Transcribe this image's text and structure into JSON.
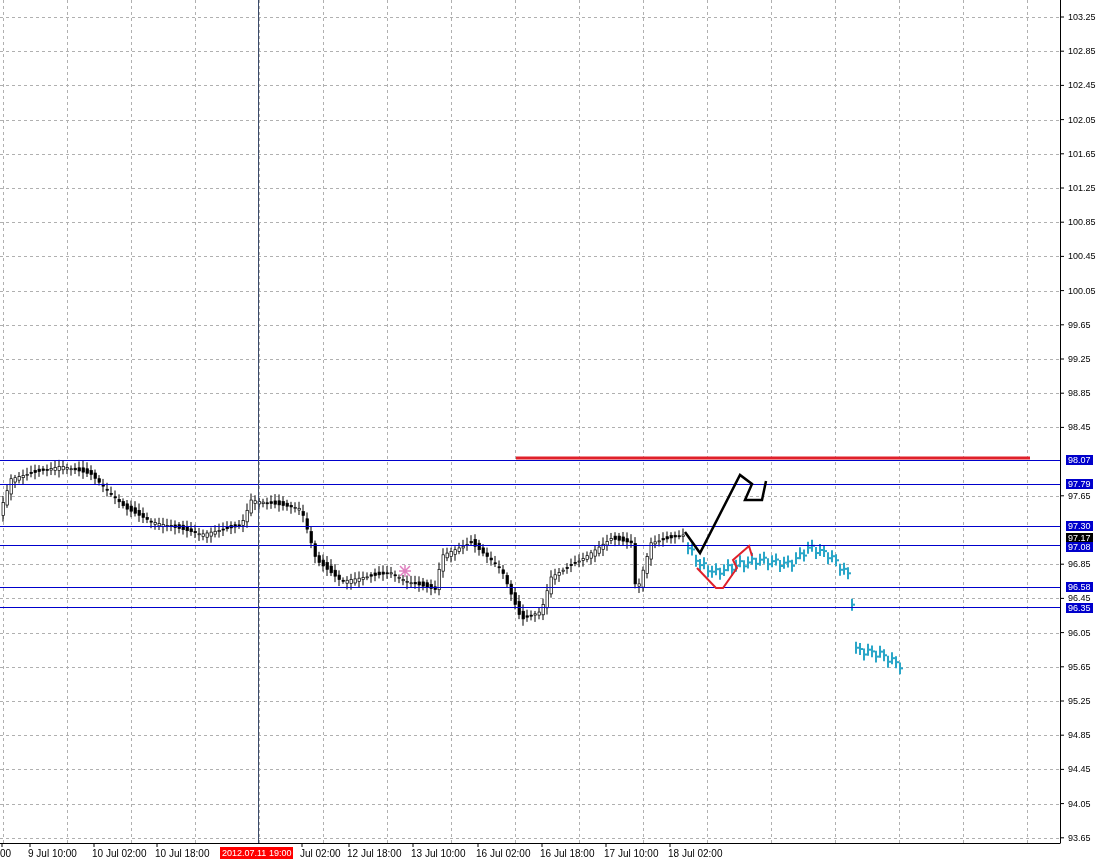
{
  "price_axis": {
    "ticks": [
      "103.25",
      "102.85",
      "102.45",
      "102.05",
      "101.65",
      "101.25",
      "100.85",
      "100.45",
      "100.05",
      "99.65",
      "99.25",
      "98.85",
      "98.45",
      "97.65",
      "96.85",
      "96.45",
      "96.05",
      "95.65",
      "95.25",
      "94.85",
      "94.45",
      "94.05",
      "93.65"
    ]
  },
  "levels": [
    {
      "label": "98.07",
      "color": "#0000cc"
    },
    {
      "label": "97.79",
      "color": "#0000cc"
    },
    {
      "label": "97.30",
      "color": "#0000cc"
    },
    {
      "label": "97.08",
      "color": "#0000cc"
    },
    {
      "label": "96.58",
      "color": "#0000cc"
    },
    {
      "label": "96.35",
      "color": "#0000cc"
    }
  ],
  "current_price": {
    "label": "97.17"
  },
  "time_axis": {
    "labels": [
      "00",
      "9 Jul 10:00",
      "10 Jul 02:00",
      "10 Jul 18:00",
      "Jul 02:00",
      "12 Jul 18:00",
      "13 Jul 10:00",
      "16 Jul 02:00",
      "16 Jul 18:00",
      "17 Jul 10:00",
      "18 Jul 02:00"
    ],
    "cursor_label": "2012.07.11 19:00"
  }
}
